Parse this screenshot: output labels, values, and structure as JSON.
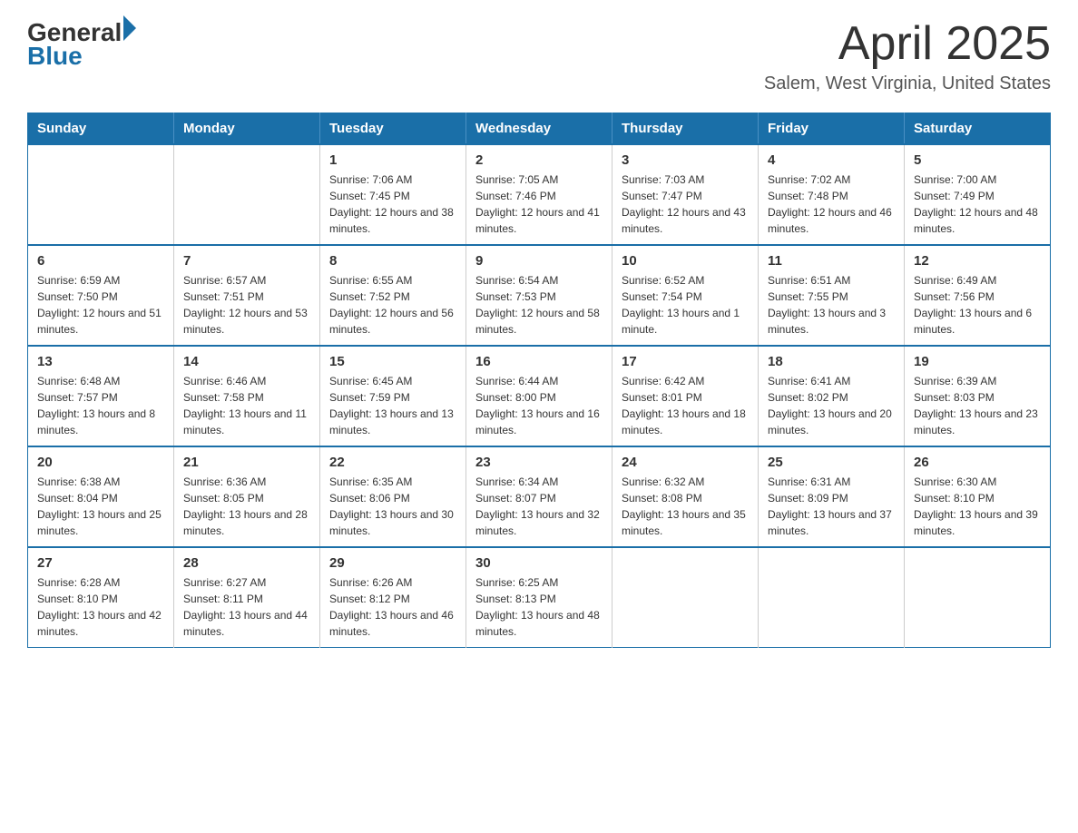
{
  "logo": {
    "general": "General",
    "blue": "Blue"
  },
  "header": {
    "month": "April 2025",
    "location": "Salem, West Virginia, United States"
  },
  "weekdays": [
    "Sunday",
    "Monday",
    "Tuesday",
    "Wednesday",
    "Thursday",
    "Friday",
    "Saturday"
  ],
  "weeks": [
    [
      {
        "day": "",
        "sunrise": "",
        "sunset": "",
        "daylight": ""
      },
      {
        "day": "",
        "sunrise": "",
        "sunset": "",
        "daylight": ""
      },
      {
        "day": "1",
        "sunrise": "Sunrise: 7:06 AM",
        "sunset": "Sunset: 7:45 PM",
        "daylight": "Daylight: 12 hours and 38 minutes."
      },
      {
        "day": "2",
        "sunrise": "Sunrise: 7:05 AM",
        "sunset": "Sunset: 7:46 PM",
        "daylight": "Daylight: 12 hours and 41 minutes."
      },
      {
        "day": "3",
        "sunrise": "Sunrise: 7:03 AM",
        "sunset": "Sunset: 7:47 PM",
        "daylight": "Daylight: 12 hours and 43 minutes."
      },
      {
        "day": "4",
        "sunrise": "Sunrise: 7:02 AM",
        "sunset": "Sunset: 7:48 PM",
        "daylight": "Daylight: 12 hours and 46 minutes."
      },
      {
        "day": "5",
        "sunrise": "Sunrise: 7:00 AM",
        "sunset": "Sunset: 7:49 PM",
        "daylight": "Daylight: 12 hours and 48 minutes."
      }
    ],
    [
      {
        "day": "6",
        "sunrise": "Sunrise: 6:59 AM",
        "sunset": "Sunset: 7:50 PM",
        "daylight": "Daylight: 12 hours and 51 minutes."
      },
      {
        "day": "7",
        "sunrise": "Sunrise: 6:57 AM",
        "sunset": "Sunset: 7:51 PM",
        "daylight": "Daylight: 12 hours and 53 minutes."
      },
      {
        "day": "8",
        "sunrise": "Sunrise: 6:55 AM",
        "sunset": "Sunset: 7:52 PM",
        "daylight": "Daylight: 12 hours and 56 minutes."
      },
      {
        "day": "9",
        "sunrise": "Sunrise: 6:54 AM",
        "sunset": "Sunset: 7:53 PM",
        "daylight": "Daylight: 12 hours and 58 minutes."
      },
      {
        "day": "10",
        "sunrise": "Sunrise: 6:52 AM",
        "sunset": "Sunset: 7:54 PM",
        "daylight": "Daylight: 13 hours and 1 minute."
      },
      {
        "day": "11",
        "sunrise": "Sunrise: 6:51 AM",
        "sunset": "Sunset: 7:55 PM",
        "daylight": "Daylight: 13 hours and 3 minutes."
      },
      {
        "day": "12",
        "sunrise": "Sunrise: 6:49 AM",
        "sunset": "Sunset: 7:56 PM",
        "daylight": "Daylight: 13 hours and 6 minutes."
      }
    ],
    [
      {
        "day": "13",
        "sunrise": "Sunrise: 6:48 AM",
        "sunset": "Sunset: 7:57 PM",
        "daylight": "Daylight: 13 hours and 8 minutes."
      },
      {
        "day": "14",
        "sunrise": "Sunrise: 6:46 AM",
        "sunset": "Sunset: 7:58 PM",
        "daylight": "Daylight: 13 hours and 11 minutes."
      },
      {
        "day": "15",
        "sunrise": "Sunrise: 6:45 AM",
        "sunset": "Sunset: 7:59 PM",
        "daylight": "Daylight: 13 hours and 13 minutes."
      },
      {
        "day": "16",
        "sunrise": "Sunrise: 6:44 AM",
        "sunset": "Sunset: 8:00 PM",
        "daylight": "Daylight: 13 hours and 16 minutes."
      },
      {
        "day": "17",
        "sunrise": "Sunrise: 6:42 AM",
        "sunset": "Sunset: 8:01 PM",
        "daylight": "Daylight: 13 hours and 18 minutes."
      },
      {
        "day": "18",
        "sunrise": "Sunrise: 6:41 AM",
        "sunset": "Sunset: 8:02 PM",
        "daylight": "Daylight: 13 hours and 20 minutes."
      },
      {
        "day": "19",
        "sunrise": "Sunrise: 6:39 AM",
        "sunset": "Sunset: 8:03 PM",
        "daylight": "Daylight: 13 hours and 23 minutes."
      }
    ],
    [
      {
        "day": "20",
        "sunrise": "Sunrise: 6:38 AM",
        "sunset": "Sunset: 8:04 PM",
        "daylight": "Daylight: 13 hours and 25 minutes."
      },
      {
        "day": "21",
        "sunrise": "Sunrise: 6:36 AM",
        "sunset": "Sunset: 8:05 PM",
        "daylight": "Daylight: 13 hours and 28 minutes."
      },
      {
        "day": "22",
        "sunrise": "Sunrise: 6:35 AM",
        "sunset": "Sunset: 8:06 PM",
        "daylight": "Daylight: 13 hours and 30 minutes."
      },
      {
        "day": "23",
        "sunrise": "Sunrise: 6:34 AM",
        "sunset": "Sunset: 8:07 PM",
        "daylight": "Daylight: 13 hours and 32 minutes."
      },
      {
        "day": "24",
        "sunrise": "Sunrise: 6:32 AM",
        "sunset": "Sunset: 8:08 PM",
        "daylight": "Daylight: 13 hours and 35 minutes."
      },
      {
        "day": "25",
        "sunrise": "Sunrise: 6:31 AM",
        "sunset": "Sunset: 8:09 PM",
        "daylight": "Daylight: 13 hours and 37 minutes."
      },
      {
        "day": "26",
        "sunrise": "Sunrise: 6:30 AM",
        "sunset": "Sunset: 8:10 PM",
        "daylight": "Daylight: 13 hours and 39 minutes."
      }
    ],
    [
      {
        "day": "27",
        "sunrise": "Sunrise: 6:28 AM",
        "sunset": "Sunset: 8:10 PM",
        "daylight": "Daylight: 13 hours and 42 minutes."
      },
      {
        "day": "28",
        "sunrise": "Sunrise: 6:27 AM",
        "sunset": "Sunset: 8:11 PM",
        "daylight": "Daylight: 13 hours and 44 minutes."
      },
      {
        "day": "29",
        "sunrise": "Sunrise: 6:26 AM",
        "sunset": "Sunset: 8:12 PM",
        "daylight": "Daylight: 13 hours and 46 minutes."
      },
      {
        "day": "30",
        "sunrise": "Sunrise: 6:25 AM",
        "sunset": "Sunset: 8:13 PM",
        "daylight": "Daylight: 13 hours and 48 minutes."
      },
      {
        "day": "",
        "sunrise": "",
        "sunset": "",
        "daylight": ""
      },
      {
        "day": "",
        "sunrise": "",
        "sunset": "",
        "daylight": ""
      },
      {
        "day": "",
        "sunrise": "",
        "sunset": "",
        "daylight": ""
      }
    ]
  ]
}
